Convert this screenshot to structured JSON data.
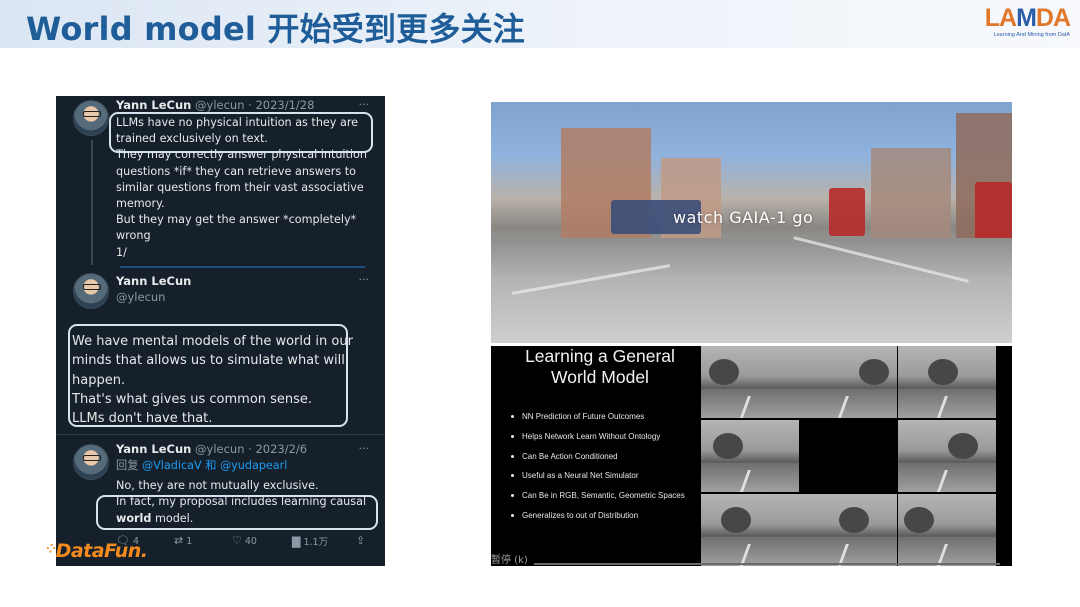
{
  "slide": {
    "title": "World model 开始受到更多关注"
  },
  "logo": {
    "lamda_part1": "LA",
    "lamda_part2": "M",
    "lamda_part3": "DA",
    "subtitle": "Learning And Mining from DatA"
  },
  "watermark": {
    "text": "DataFun."
  },
  "twitter": {
    "tweets": [
      {
        "author": "Yann LeCun",
        "handle": "@ylecun · 2023/1/28",
        "lines": [
          "LLMs have no physical intuition as they are",
          "trained exclusively on text.",
          "They may correctly answer physical intuition",
          "questions *if* they can retrieve answers to",
          "similar questions from their vast associative",
          "memory.",
          "But they may get the answer *completely*",
          "wrong",
          "1/"
        ]
      },
      {
        "author": "Yann LeCun",
        "handle": "@ylecun",
        "lines": [
          "We have mental models of the world in our",
          "minds that allows us to simulate what will",
          "happen.",
          "That's what gives us common sense.",
          "LLMs don't have that."
        ]
      },
      {
        "author": "Yann LeCun",
        "handle": "@ylecun · 2023/2/6",
        "reply_prefix": "回复",
        "reply_to_1": "@VladicaV",
        "reply_and": "和",
        "reply_to_2": "@yudapearl",
        "lines": [
          "No, they are not mutually exclusive.",
          "In fact, my proposal includes learning causal"
        ],
        "last_line_bold": "world",
        "last_line_rest": " model.",
        "actions": {
          "reply_count": "4",
          "retweet_count": "1",
          "like_count": "40",
          "view_count": "1.1万"
        }
      }
    ],
    "more_glyph": "···"
  },
  "video": {
    "top_caption": "watch GAIA-1 go",
    "slide_title_line1": "Learning a General",
    "slide_title_line2": "World Model",
    "bullets": [
      "NN Prediction of Future Outcomes",
      "Helps Network Learn Without Ontology",
      "Can Be Action Conditioned",
      "Useful as a Neural Net Simulator",
      "Can Be in RGB, Semantic, Geometric Spaces",
      "Generalizes to out of Distribution"
    ],
    "pause_label": "暂停 (k)"
  },
  "colors": {
    "title_blue": "#1f5d99",
    "twitter_bg": "#15202b",
    "twitter_link": "#1d9bf0",
    "highlight_box": "#d6e2ef",
    "datafun_orange": "#f28a1e"
  }
}
